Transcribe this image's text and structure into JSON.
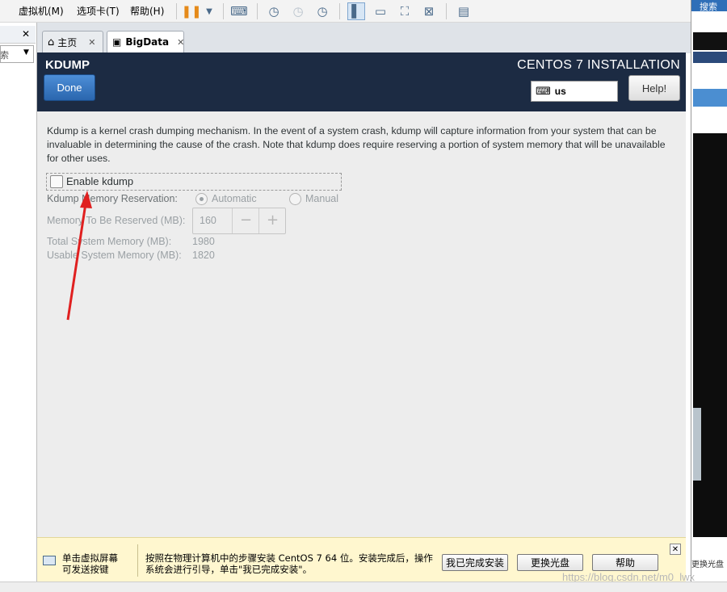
{
  "menubar": {
    "items": [
      "虚拟机(M)",
      "选项卡(T)",
      "帮助(H)"
    ]
  },
  "library": {
    "close_glyph": "✕",
    "search_text": "搜索"
  },
  "tabs": [
    {
      "label": "主页",
      "icon": "home-icon"
    },
    {
      "label": "BigData",
      "icon": "vm-icon"
    }
  ],
  "tab_close_glyph": "✕",
  "installer": {
    "screen_title": "KDUMP",
    "product_title": "CENTOS 7 INSTALLATION",
    "done_label": "Done",
    "keyboard_layout": "us",
    "help_label": "Help!",
    "description": "Kdump is a kernel crash dumping mechanism. In the event of a system crash, kdump will capture information from your system that can be invaluable in determining the cause of the crash. Note that kdump does require reserving a portion of system memory that will be unavailable for other uses.",
    "enable_label": "Enable kdump",
    "enable_checked": false,
    "reservation_label": "Kdump Memory Reservation:",
    "automatic_label": "Automatic",
    "manual_label": "Manual",
    "reservation_mode": "Automatic",
    "to_reserve_label": "Memory To Be Reserved (MB):",
    "to_reserve_value": "160",
    "minus": "−",
    "plus": "+",
    "total_label": "Total System Memory (MB):",
    "total_value": "1980",
    "usable_label": "Usable System Memory (MB):",
    "usable_value": "1820"
  },
  "hint_bar": {
    "left_line1": "单击虚拟屏幕",
    "left_line2": "可发送按键",
    "main": "按照在物理计算机中的步骤安装 CentOS 7 64 位。安装完成后，操作系统会进行引导，单击\"我已完成安装\"。",
    "btn_done": "我已完成安装",
    "btn_change_disc": "更换光盘",
    "btn_help": "帮助",
    "close_glyph": "✕"
  },
  "right_strip": {
    "top_text": "搜索",
    "bottom_text": "更换光盘"
  },
  "watermark": "https://blog.csdn.net/m0_lwx",
  "colors": {
    "header_bg": "#1c2b43",
    "done_blue": "#2a66ae",
    "hint_bg": "#fff7cf",
    "annotation_arrow": "#e02020"
  }
}
